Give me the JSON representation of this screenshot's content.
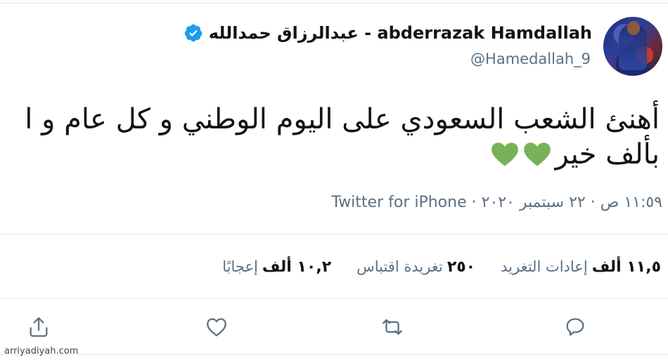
{
  "colors": {
    "accent": "#1d9bf0",
    "heart": "#78b159",
    "muted": "#5b7083",
    "text": "#0f1419"
  },
  "user": {
    "display_name": "عبدالرزاق حمدالله - abderrazak Hamdallah",
    "handle": "@Hamedallah_9",
    "verified_icon": "verified-badge-icon"
  },
  "tweet": {
    "line1": "أهنئ الشعب السعودي على اليوم الوطني و كل عام و ا",
    "line2": "بألف خير",
    "emoji": [
      "green-heart-icon",
      "green-heart-icon"
    ]
  },
  "meta": {
    "time_date": "١١:٥٩ ص · ٢٢ سبتمبر ٢٠٢٠ ·",
    "source": "Twitter for iPhone"
  },
  "stats": [
    {
      "value": "١١,٥ ألف",
      "label": "إعادات التغريد"
    },
    {
      "value": "٢٥٠",
      "label": "تغريدة اقتباس"
    },
    {
      "value": "١٠,٢ ألف",
      "label": "إعجابًا"
    }
  ],
  "actions": {
    "reply_icon": "reply-icon",
    "retweet_icon": "retweet-icon",
    "like_icon": "like-icon",
    "share_icon": "share-icon"
  },
  "watermark": "arriyadiyah.com"
}
